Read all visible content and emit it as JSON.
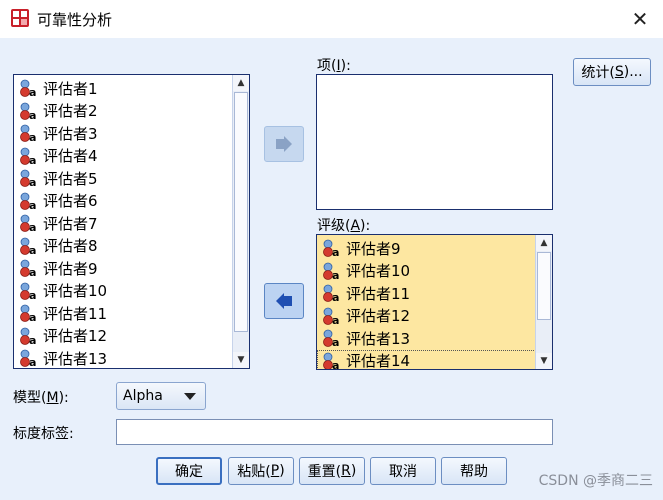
{
  "window": {
    "title": "可靠性分析",
    "close_glyph": "✕"
  },
  "source_list": {
    "items": [
      "评估者1",
      "评估者2",
      "评估者3",
      "评估者4",
      "评估者5",
      "评估者6",
      "评估者7",
      "评估者8",
      "评估者9",
      "评估者10",
      "评估者11",
      "评估者12",
      "评估者13"
    ]
  },
  "items_box": {
    "label_pre": "项(",
    "label_key": "I",
    "label_post": "):"
  },
  "ratings_box": {
    "label_pre": "评级(",
    "label_key": "A",
    "label_post": "):",
    "items": [
      "评估者9",
      "评估者10",
      "评估者11",
      "评估者12",
      "评估者13",
      "评估者14"
    ]
  },
  "buttons": {
    "stats_pre": "统计(",
    "stats_key": "S",
    "stats_post": ")...",
    "ok": "确定",
    "paste_pre": "粘贴(",
    "paste_key": "P",
    "paste_post": ")",
    "reset_pre": "重置(",
    "reset_key": "R",
    "reset_post": ")",
    "cancel": "取消",
    "help": "帮助"
  },
  "model": {
    "label_pre": "模型(",
    "label_key": "M",
    "label_post": "):",
    "value": "Alpha"
  },
  "scale_label": {
    "label": "标度标签:",
    "value": ""
  },
  "watermark": "CSDN @季商二三",
  "colors": {
    "selection": "#fde7a1",
    "dialog_bg": "#e8f0fb",
    "border": "#1a2f6e"
  }
}
